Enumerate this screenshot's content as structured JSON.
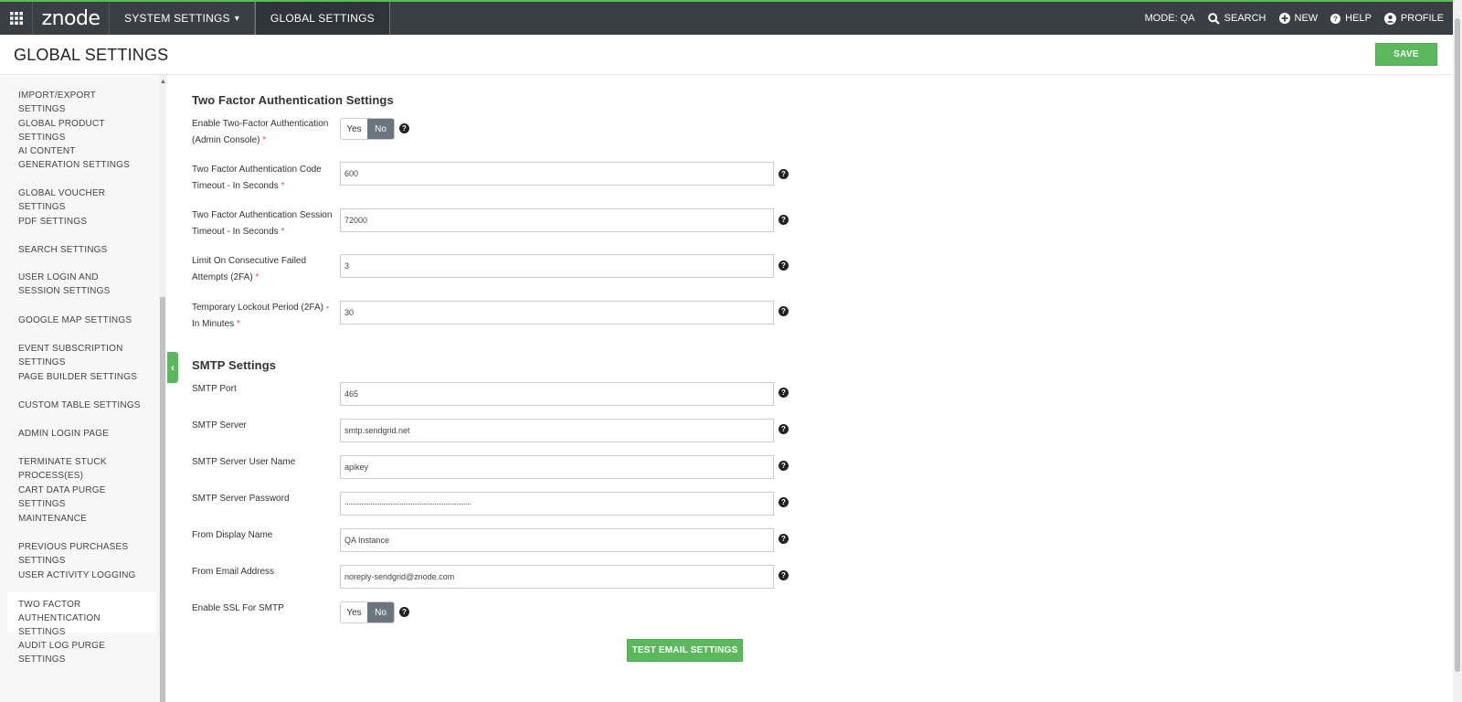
{
  "topbar": {
    "logo": "znode",
    "nav": [
      {
        "label": "SYSTEM SETTINGS"
      },
      {
        "label": "GLOBAL SETTINGS"
      }
    ],
    "mode": "MODE: QA",
    "search": "SEARCH",
    "new": "NEW",
    "help": "HELP",
    "profile": "PROFILE"
  },
  "header": {
    "title": "GLOBAL SETTINGS",
    "save_label": "SAVE"
  },
  "sidebar": {
    "items": [
      {
        "label": "IMPORT/EXPORT SETTINGS"
      },
      {
        "label": "GLOBAL PRODUCT SETTINGS"
      },
      {
        "label": "AI CONTENT GENERATION SETTINGS"
      },
      {
        "label": "GLOBAL VOUCHER SETTINGS"
      },
      {
        "label": "PDF SETTINGS"
      },
      {
        "label": "SEARCH SETTINGS"
      },
      {
        "label": "USER LOGIN AND SESSION SETTINGS"
      },
      {
        "label": "GOOGLE MAP SETTINGS"
      },
      {
        "label": "EVENT SUBSCRIPTION SETTINGS"
      },
      {
        "label": "PAGE BUILDER SETTINGS"
      },
      {
        "label": "CUSTOM TABLE SETTINGS"
      },
      {
        "label": "ADMIN LOGIN PAGE"
      },
      {
        "label": "TERMINATE STUCK PROCESS(ES)"
      },
      {
        "label": "CART DATA PURGE SETTINGS"
      },
      {
        "label": "MAINTENANCE"
      },
      {
        "label": "PREVIOUS PURCHASES SETTINGS"
      },
      {
        "label": "USER ACTIVITY LOGGING"
      },
      {
        "label": "TWO FACTOR AUTHENTICATION SETTINGS"
      },
      {
        "label": "AUDIT LOG PURGE SETTINGS"
      }
    ]
  },
  "two_factor": {
    "title": "Two Factor Authentication Settings",
    "enable_label": "Enable Two-Factor Authentication (Admin Console)",
    "code_timeout_label": "Two Factor Authentication Code Timeout - In Seconds",
    "code_timeout_value": "600",
    "session_timeout_label": "Two Factor Authentication Session Timeout - In Seconds",
    "session_timeout_value": "72000",
    "failed_attempts_label": "Limit On Consecutive Failed Attempts (2FA)",
    "failed_attempts_value": "3",
    "lockout_label": "Temporary Lockout Period (2FA) - In Minutes",
    "lockout_value": "30"
  },
  "smtp": {
    "title": "SMTP Settings",
    "port_label": "SMTP Port",
    "port_value": "465",
    "server_label": "SMTP Server",
    "server_value": "smtp.sendgrid.net",
    "user_label": "SMTP Server User Name",
    "user_value": "apikey",
    "password_label": "SMTP Server Password",
    "password_value": "·····································································",
    "display_name_label": "From Display Name",
    "display_name_value": "QA Instance",
    "email_label": "From Email Address",
    "email_value": "noreply-sendgrid@znode.com",
    "ssl_label": "Enable SSL For SMTP",
    "test_label": "TEST EMAIL SETTINGS"
  },
  "toggle": {
    "yes": "Yes",
    "no": "No"
  },
  "required_mark": "*",
  "help_glyph": "?"
}
